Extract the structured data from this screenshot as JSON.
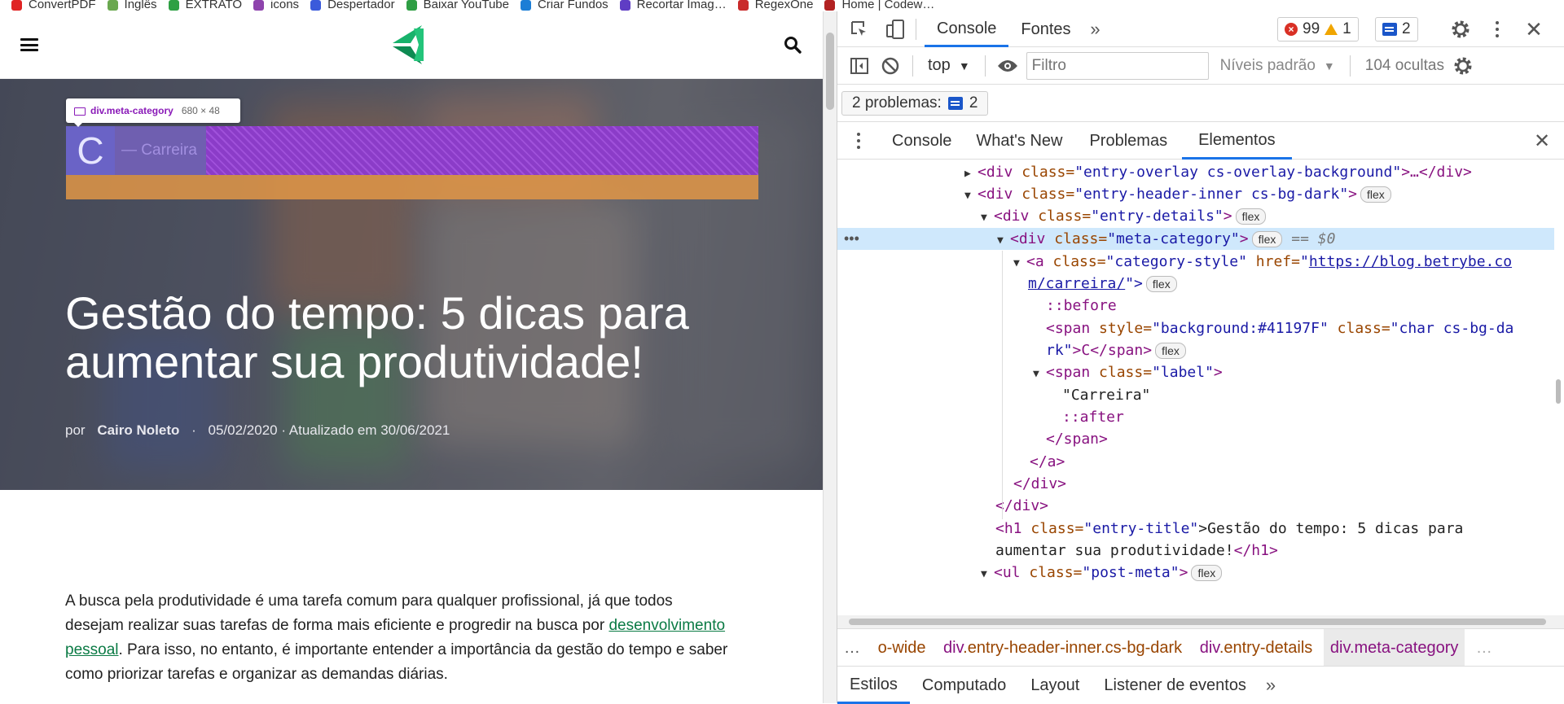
{
  "bookmarks": [
    {
      "label": "ConvertPDF",
      "color": "#e02424"
    },
    {
      "label": "Inglês",
      "color": "#6aa84f"
    },
    {
      "label": "EXTRATO",
      "color": "#2ea043"
    },
    {
      "label": "icons",
      "color": "#8e44ad"
    },
    {
      "label": "Despertador",
      "color": "#3b5bdb"
    },
    {
      "label": "Baixar YouTube",
      "color": "#2f9e44"
    },
    {
      "label": "Criar Fundos",
      "color": "#1c7ed6"
    },
    {
      "label": "Recortar Imag…",
      "color": "#5f3dc4"
    },
    {
      "label": "RegexOne",
      "color": "#c92a2a"
    },
    {
      "label": "Home | Codew…",
      "color": "#b22222"
    }
  ],
  "tooltip": {
    "selector": "div.meta-category",
    "dims": "680 × 48"
  },
  "highlight": {
    "char": "C",
    "label": "— Carreira"
  },
  "hero": {
    "title": "Gestão do tempo: 5 dicas para aumentar sua produtividade!",
    "by": "por",
    "author": "Cairo Noleto",
    "sep": "·",
    "dates": "05/02/2020 · Atualizado em 30/06/2021"
  },
  "article": {
    "p1_before": "A busca pela produtividade é uma tarefa comum para qualquer profissional, já que todos desejam realizar suas tarefas de forma mais eficiente e progredir na busca por ",
    "p1_link": "desenvolvimento pessoal",
    "p1_after": ". Para isso, no entanto, é importante entender a importância da gestão do tempo e saber como priorizar tarefas e organizar as demandas diárias."
  },
  "devtools": {
    "main_tabs": [
      "Console",
      "Fontes"
    ],
    "active_main_tab": "Console",
    "errors": "99",
    "warnings": "1",
    "messages": "2",
    "context": "top",
    "filter_placeholder": "Filtro",
    "levels": "Níveis padrão",
    "hidden": "104 ocultas",
    "issues_label": "2 problemas:",
    "issues_count": "2",
    "drawer_tabs": [
      "Console",
      "What's New",
      "Problemas",
      "Elementos"
    ],
    "active_drawer_tab": "Elementos",
    "breadcrumbs": [
      {
        "tag": "",
        "cls": "o-wide"
      },
      {
        "tag": "div",
        "cls": ".entry-header-inner.cs-bg-dark"
      },
      {
        "tag": "div",
        "cls": ".entry-details"
      },
      {
        "tag": "div",
        "cls": ".meta-category"
      }
    ],
    "styles_tabs": [
      "Estilos",
      "Computado",
      "Layout",
      "Listener de eventos"
    ],
    "active_styles_tab": "Estilos",
    "dom": {
      "l1_tag": "<div ",
      "l1_attr": "class=",
      "l1_val": "\"entry-overlay cs-overlay-background\"",
      "l1_end": ">…</div>",
      "l2_tag": "<div ",
      "l2_attr": "class=",
      "l2_val": "\"entry-header-inner cs-bg-dark\"",
      "l2_end": ">",
      "l3_tag": "<div ",
      "l3_attr": "class=",
      "l3_val": "\"entry-details\"",
      "l3_end": ">",
      "l4_tag": "<div ",
      "l4_attr": "class=",
      "l4_val": "\"meta-category\"",
      "l4_end": ">",
      "l4_eq": "== $0",
      "l5_tag": "<a ",
      "l5_attr": "class=",
      "l5_val": "\"category-style\"",
      "l5_attr2": " href=",
      "l5_link1": "https://blog.betrybe.co",
      "l6_link2": "m/carreira/",
      "l6_end": "\">",
      "l7": "::before",
      "l8_tag": "<span ",
      "l8_attr": "style=",
      "l8_val": "\"background:#41197F\"",
      "l8_attr2": " class=",
      "l8_val2": "\"char cs-bg-da",
      "l9_val": "rk\"",
      "l9_end": ">C</span>",
      "l10_tag": "<span ",
      "l10_attr": "class=",
      "l10_val": "\"label\"",
      "l10_end": ">",
      "l11": "\"Carreira\"",
      "l12": "::after",
      "l13": "</span>",
      "l14": "</a>",
      "l15": "</div>",
      "l16": "</div>",
      "l17_tag": "<h1 ",
      "l17_attr": "class=",
      "l17_val": "\"entry-title\"",
      "l17_text": ">Gestão do tempo: 5 dicas para",
      "l18_text": "aumentar sua produtividade!",
      "l18_end": "</h1>",
      "l19_tag": "<ul ",
      "l19_attr": "class=",
      "l19_val": "\"post-meta\"",
      "l19_end": ">",
      "flex": "flex"
    }
  }
}
